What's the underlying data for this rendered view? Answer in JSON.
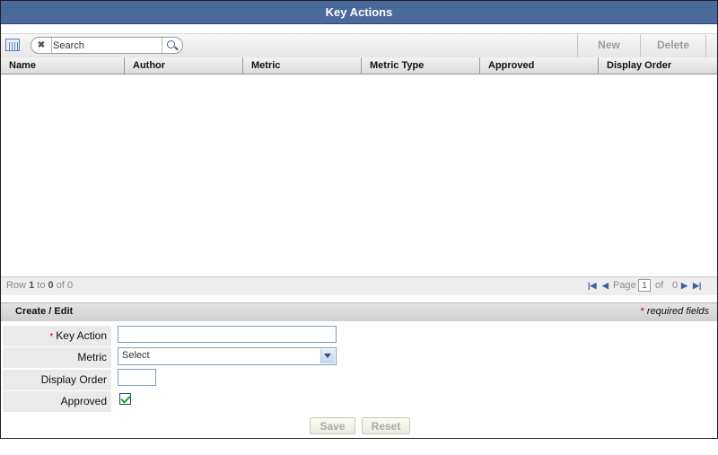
{
  "window": {
    "title": "Key Actions"
  },
  "toolbar": {
    "search_placeholder": "Search",
    "new_label": "New",
    "delete_label": "Delete"
  },
  "grid": {
    "columns": [
      "Name",
      "Author",
      "Metric",
      "Metric Type",
      "Approved",
      "Display Order"
    ],
    "rows": []
  },
  "pager": {
    "row_label": "Row",
    "row_start": "1",
    "to_label": "to",
    "row_end": "0",
    "of_label": "of",
    "row_total": "0",
    "page_label": "Page",
    "page_value": "1",
    "page_of_label": "of",
    "page_total": "0"
  },
  "form": {
    "section_title": "Create / Edit",
    "required_note": "required fields",
    "required_star": "*",
    "key_action_label": "Key Action",
    "key_action_value": "",
    "metric_label": "Metric",
    "metric_selected": "Select",
    "display_order_label": "Display Order",
    "display_order_value": "",
    "approved_label": "Approved",
    "approved_checked": true,
    "save_label": "Save",
    "reset_label": "Reset"
  },
  "colors": {
    "title_bar": "#4a6a9b",
    "required_star": "#cc0000",
    "checkmark": "#21a121",
    "pager_icons": "#3d5f9b"
  },
  "icons": [
    "column-chooser-icon",
    "clear-search-icon",
    "search-icon",
    "first-page-icon",
    "prev-page-icon",
    "next-page-icon",
    "last-page-icon",
    "dropdown-arrow-icon",
    "checkmark-icon"
  ]
}
